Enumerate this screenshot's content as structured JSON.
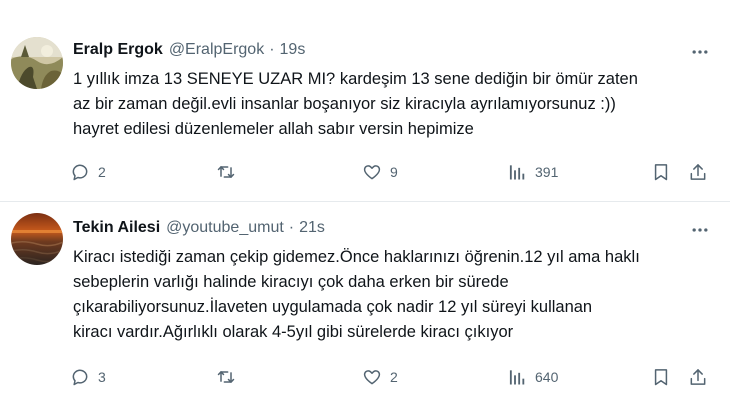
{
  "tweets": [
    {
      "author_name": "Eralp Ergok",
      "handle": "@EralpErgok",
      "separator": "·",
      "time": "19s",
      "text_lines": [
        "1 yıllık imza 13 SENEYE UZAR MI? kardeşim 13 sene dediğin bir ömür zaten",
        "az bir zaman değil.evli insanlar boşanıyor siz kiracıyla ayrılamıyorsunuz :))",
        "hayret edilesi düzenlemeler allah sabır versin hepimize"
      ],
      "replies": "2",
      "retweets": "",
      "likes": "9",
      "views": "391"
    },
    {
      "author_name": "Tekin Ailesi",
      "handle": "@youtube_umut",
      "separator": "·",
      "time": "21s",
      "text_lines": [
        "Kiracı istediği zaman çekip gidemez.Önce haklarınızı öğrenin.12 yıl ama haklı",
        "sebeplerin varlığı halinde kiracıyı çok daha erken bir sürede",
        "çıkarabiliyorsunuz.İlaveten uygulamada çok nadir 12 yıl süreyi kullanan",
        "kiracı vardır.Ağırlıklı olarak 4-5yıl gibi sürelerde kiracı çıkıyor"
      ],
      "replies": "3",
      "retweets": "",
      "likes": "2",
      "views": "640"
    }
  ],
  "icons": {
    "more": "more-horizontal-icon",
    "reply": "reply-bubble-icon",
    "retweet": "retweet-icon",
    "like": "heart-icon",
    "views": "views-bar-chart-icon",
    "bookmark": "bookmark-icon",
    "share": "share-upload-icon"
  },
  "colors": {
    "text": "#0f1419",
    "secondary": "#536471",
    "divider": "#e6eaed"
  }
}
